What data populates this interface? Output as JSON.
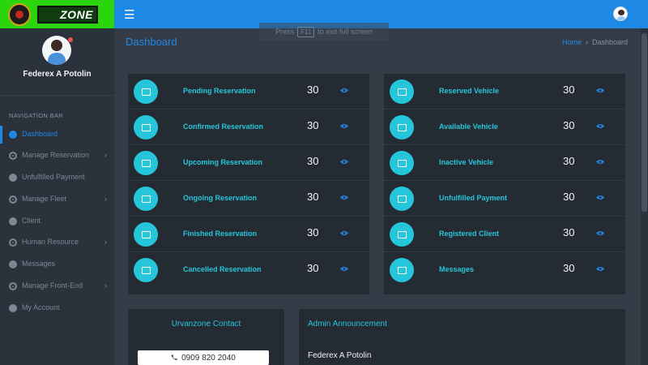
{
  "brand": {
    "logo_text": "ZONE"
  },
  "fullscreen_hint": {
    "prefix": "Press",
    "key": "F11",
    "suffix": "to exit full screen"
  },
  "profile": {
    "name": "Federex A Potolin"
  },
  "nav": {
    "section_label": "NAVIGATION BAR",
    "items": [
      {
        "label": "Dashboard",
        "active": true
      },
      {
        "label": "Manage Reservation",
        "chevron": true
      },
      {
        "label": "Unfulfilled Payment"
      },
      {
        "label": "Manage Fleet",
        "chevron": true
      },
      {
        "label": "Client"
      },
      {
        "label": "Human Resource",
        "chevron": true
      },
      {
        "label": "Messages"
      },
      {
        "label": "Manage Front-End",
        "chevron": true
      },
      {
        "label": "My Account"
      }
    ],
    "chevron_glyph": "›"
  },
  "page": {
    "title": "Dashboard"
  },
  "breadcrumb": {
    "home": "Home",
    "separator": "›",
    "current": "Dashboard"
  },
  "stats_left": [
    {
      "label": "Pending Reservation",
      "count": "30"
    },
    {
      "label": "Confirmed Reservation",
      "count": "30"
    },
    {
      "label": "Upcoming Reservation",
      "count": "30"
    },
    {
      "label": "Ongoing Reservation",
      "count": "30"
    },
    {
      "label": "Finished Reservation",
      "count": "30"
    },
    {
      "label": "Cancelled Reservation",
      "count": "30"
    }
  ],
  "stats_right": [
    {
      "label": "Reserved Vehicle",
      "count": "30"
    },
    {
      "label": "Available Vehicle",
      "count": "30"
    },
    {
      "label": "Inactive Vehicle",
      "count": "30"
    },
    {
      "label": "Unfulfilled Payment",
      "count": "30"
    },
    {
      "label": "Registered Client",
      "count": "30"
    },
    {
      "label": "Messages",
      "count": "30"
    }
  ],
  "contact": {
    "title": "Urvanzone Contact",
    "phone": "0909 820 2040"
  },
  "announcement": {
    "title": "Admin Announcement",
    "author": "Federex A Potolin"
  },
  "colors": {
    "accent": "#1e88e5",
    "teal": "#26c6da",
    "logo_green": "#2ad50c"
  }
}
